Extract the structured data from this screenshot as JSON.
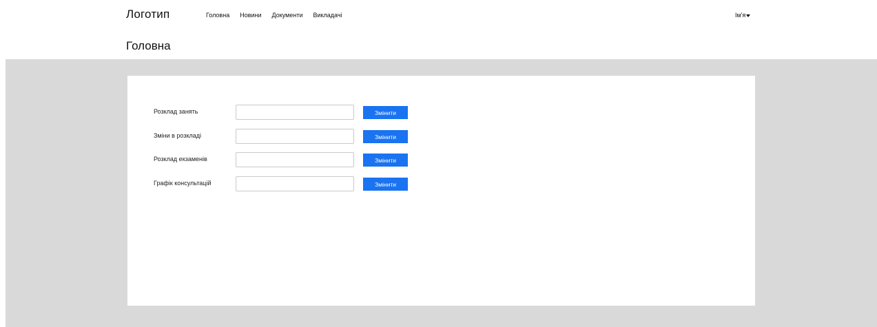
{
  "header": {
    "logo": "Логотип",
    "nav": [
      "Головна",
      "Новини",
      "Документи",
      "Викладачі"
    ],
    "user": "Ім'я"
  },
  "page": {
    "title": "Головна"
  },
  "form": {
    "rows": [
      {
        "label": "Розклад занять",
        "value": "",
        "button": "Змінити"
      },
      {
        "label": "Зміни в розкладі",
        "value": "",
        "button": "Змінити"
      },
      {
        "label": "Розклад екзаменів",
        "value": "",
        "button": "Змінити"
      },
      {
        "label": "Графік консультацій",
        "value": "",
        "button": "Змінити"
      }
    ]
  },
  "colors": {
    "accent": "#1a73f0",
    "background": "#d9d9d9",
    "card": "#ffffff"
  },
  "icons": {
    "user_menu_caret": "caret-down-icon"
  }
}
